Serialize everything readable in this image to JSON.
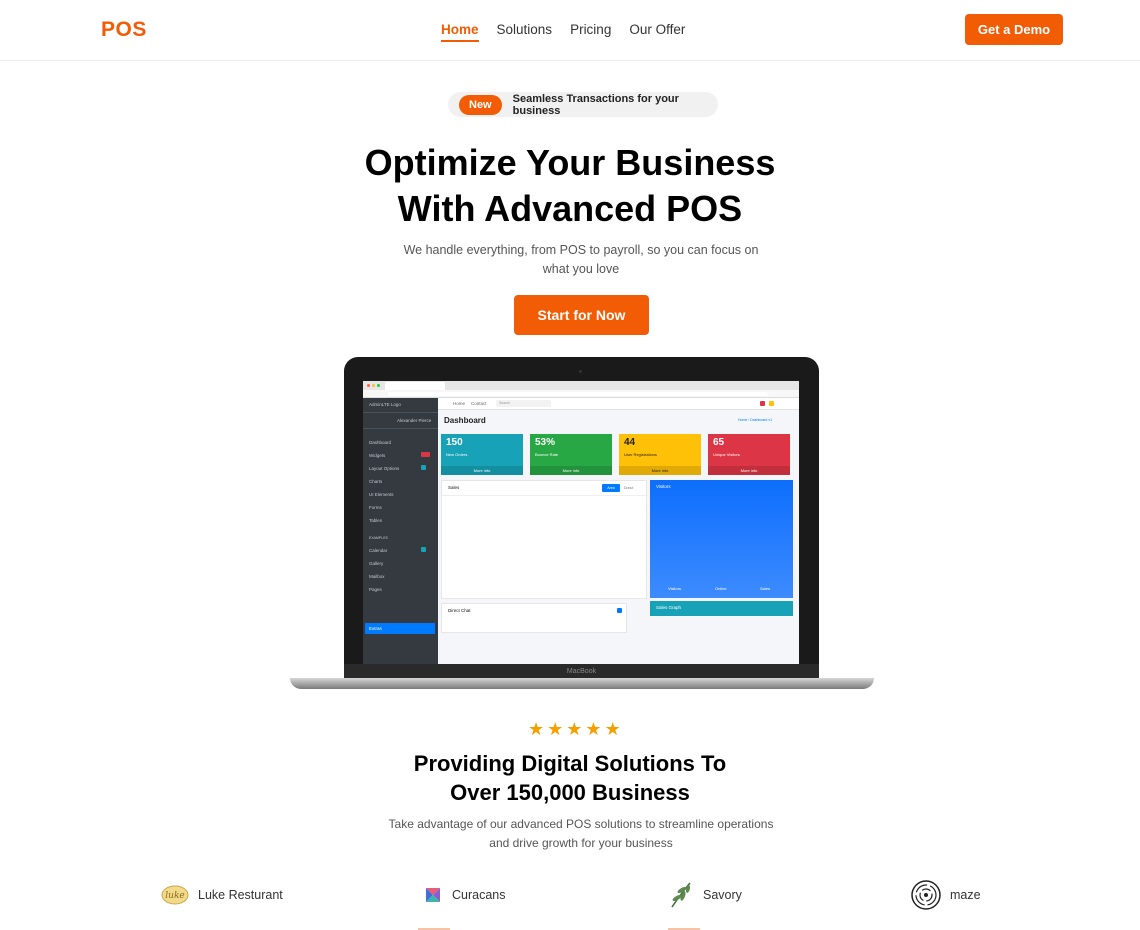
{
  "nav": {
    "logo": "POS",
    "links": [
      "Home",
      "Solutions",
      "Pricing",
      "Our Offer"
    ],
    "demo_button": "Get a Demo"
  },
  "hero": {
    "badge": "New",
    "badge_text": "Seamless Transactions for your business",
    "title_line1": "Optimize Your Business",
    "title_line2": "With Advanced POS",
    "subtitle": "We handle everything, from POS to payroll, so you can focus on what you love",
    "cta": "Start for Now"
  },
  "laptop": {
    "brand": "MacBook",
    "dashboard": {
      "title": "Dashboard",
      "breadcrumb": "Home / Dashboard v1",
      "top_links": [
        "Home",
        "Contact"
      ],
      "search_placeholder": "Search",
      "brand": "AdminLTE Logo",
      "user": "Alexander Pierce",
      "sidebar_items": [
        "Dashboard",
        "Widgets",
        "Layout Options",
        "Charts",
        "UI Elements",
        "Forms",
        "Tables",
        "EXAMPLES",
        "Calendar",
        "Gallery",
        "Mailbox",
        "Pages",
        "Extras"
      ],
      "boxes": [
        {
          "value": "150",
          "label": "New Orders",
          "footer": "More info",
          "color": "#17a2b8"
        },
        {
          "value": "53%",
          "label": "Bounce Rate",
          "footer": "More info",
          "color": "#28a745"
        },
        {
          "value": "44",
          "label": "User Registrations",
          "footer": "More info",
          "color": "#ffc107"
        },
        {
          "value": "65",
          "label": "Unique Visitors",
          "footer": "More info",
          "color": "#dc3545"
        }
      ],
      "sales_card": {
        "title": "Sales",
        "tabs": [
          "Area",
          "Donut"
        ]
      },
      "visitors_card": {
        "title": "Visitors",
        "stats": [
          "Visitors",
          "Online",
          "Sales"
        ]
      },
      "direct_chat": "Direct Chat",
      "sales_graph": "Sales Graph"
    }
  },
  "social_proof": {
    "rating_stars": 5,
    "title_line1": "Providing Digital Solutions To",
    "title_line2": "Over 150,000 Business",
    "subtitle": "Take advantage of our advanced POS solutions to streamline operations and drive growth for your business",
    "clients": [
      {
        "name": "Luke Resturant",
        "icon": "luke-logo-icon"
      },
      {
        "name": "Curacans",
        "icon": "curacans-logo-icon"
      },
      {
        "name": "Savory",
        "icon": "savory-logo-icon"
      },
      {
        "name": "maze",
        "icon": "maze-logo-icon"
      }
    ]
  },
  "colors": {
    "accent": "#f25c05",
    "star": "#f5a000"
  }
}
